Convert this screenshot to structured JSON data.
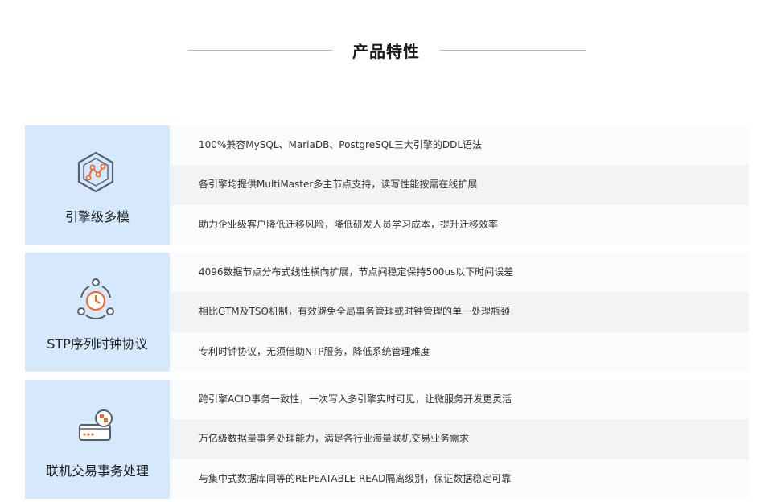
{
  "section": {
    "title": "产品特性"
  },
  "colors": {
    "label_bg": "#d6e8fb",
    "icon_stroke": "#555f6d",
    "icon_accent": "#ee6b2a",
    "row_light": "#fafbfc",
    "row_dark": "#f2f3f5"
  },
  "features": [
    {
      "name": "引擎级多模",
      "icon": "hexagon-graph-icon",
      "rows": [
        "100%兼容MySQL、MariaDB、PostgreSQL三大引擎的DDL语法",
        "各引擎均提供MultiMaster多主节点支持，读写性能按需在线扩展",
        "助力企业级客户降低迁移风险，降低研发人员学习成本，提升迁移效率"
      ]
    },
    {
      "name": "STP序列时钟协议",
      "icon": "clock-network-icon",
      "rows": [
        "4096数据节点分布式线性横向扩展，节点间稳定保持500us以下时间误差",
        "相比GTM及TSO机制，有效避免全局事务管理或时钟管理的单一处理瓶颈",
        "专利时钟协议，无须借助NTP服务，降低系统管理难度"
      ]
    },
    {
      "name": "联机交易事务处理",
      "icon": "transaction-card-icon",
      "rows": [
        "跨引擎ACID事务一致性，一次写入多引擎实时可见，让微服务开发更灵活",
        "万亿级数据量事务处理能力，满足各行业海量联机交易业务需求",
        "与集中式数据库同等的REPEATABLE READ隔离级别，保证数据稳定可靠"
      ]
    }
  ]
}
